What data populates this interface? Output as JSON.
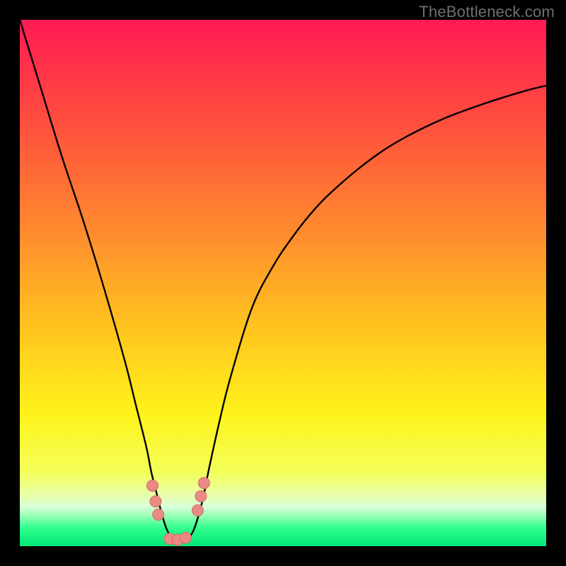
{
  "watermark": "TheBottleneck.com",
  "colors": {
    "frame": "#000000",
    "gradient_stops": [
      {
        "offset": 0.0,
        "color": "#ff1a55"
      },
      {
        "offset": 0.18,
        "color": "#ff4a3f"
      },
      {
        "offset": 0.4,
        "color": "#ff8a2e"
      },
      {
        "offset": 0.58,
        "color": "#ffc21f"
      },
      {
        "offset": 0.75,
        "color": "#fff31a"
      },
      {
        "offset": 0.86,
        "color": "#f3ff5a"
      },
      {
        "offset": 0.905,
        "color": "#e8ffb0"
      },
      {
        "offset": 0.925,
        "color": "#d9ffd9"
      },
      {
        "offset": 0.945,
        "color": "#8cffb0"
      },
      {
        "offset": 0.965,
        "color": "#32ff8f"
      },
      {
        "offset": 1.0,
        "color": "#00e676"
      }
    ],
    "curve": "#000000",
    "marker_fill": "#e98b84",
    "marker_stroke": "#d46a63"
  },
  "chart_data": {
    "type": "line",
    "title": "",
    "xlabel": "",
    "ylabel": "",
    "xlim": [
      0,
      100
    ],
    "ylim": [
      0,
      100
    ],
    "grid": false,
    "legend": false,
    "note": "Axis values are estimated from pixel positions; the figure has no visible tick labels.",
    "series": [
      {
        "name": "curve",
        "x": [
          0,
          4,
          8,
          12,
          16,
          20,
          22,
          24,
          25,
          26,
          27,
          28,
          29,
          30,
          31,
          32,
          33,
          34,
          35,
          36,
          38,
          40,
          44,
          48,
          52,
          56,
          60,
          66,
          72,
          80,
          88,
          96,
          100
        ],
        "y": [
          100,
          87,
          74,
          62,
          49,
          35,
          27,
          19,
          14,
          10,
          6,
          3,
          1.5,
          1,
          1,
          1.5,
          3,
          6,
          10,
          15,
          24,
          32,
          45,
          53,
          59,
          64,
          68,
          73,
          77,
          81,
          84,
          86.5,
          87.5
        ]
      }
    ],
    "markers": [
      {
        "x": 25.2,
        "y": 11.5
      },
      {
        "x": 25.8,
        "y": 8.5
      },
      {
        "x": 26.3,
        "y": 6.0
      },
      {
        "x": 28.5,
        "y": 1.4
      },
      {
        "x": 30.0,
        "y": 1.2
      },
      {
        "x": 31.5,
        "y": 1.6
      },
      {
        "x": 33.8,
        "y": 6.8
      },
      {
        "x": 34.4,
        "y": 9.5
      },
      {
        "x": 35.0,
        "y": 12.0
      }
    ],
    "marker_radius_px": 8
  }
}
